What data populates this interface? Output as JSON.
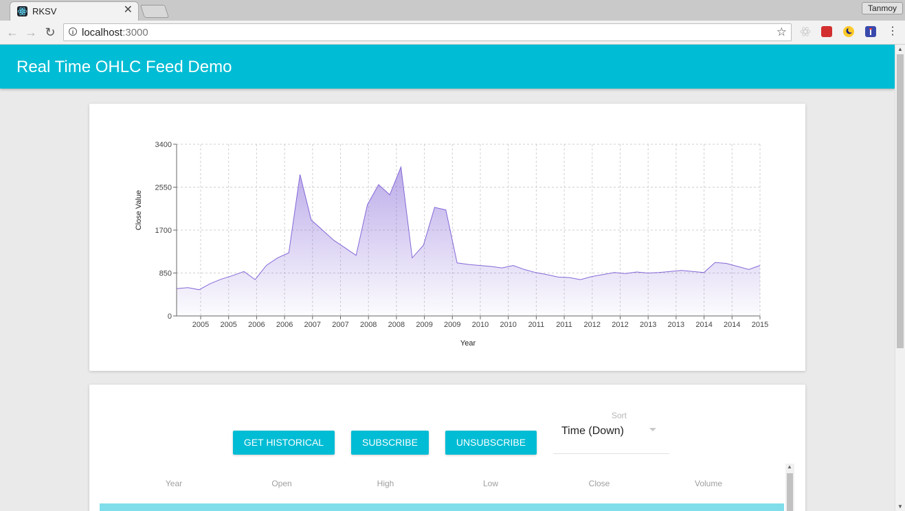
{
  "browser": {
    "tab_title": "RKSV",
    "tab_close": "✕",
    "profile_name": "Tanmoy",
    "url_host": "localhost",
    "url_port": ":3000",
    "star": "☆",
    "menu": "⋮",
    "back": "←",
    "forward": "→",
    "reload": "↻"
  },
  "app": {
    "title": "Real Time OHLC Feed Demo",
    "accent_color": "#00bcd4"
  },
  "chart_data": {
    "type": "area",
    "xlabel": "Year",
    "ylabel": "Close Value",
    "ylim": [
      0,
      3400
    ],
    "yticks": [
      "0",
      "850",
      "1700",
      "2550",
      "3400"
    ],
    "xticks": [
      "2005",
      "2005",
      "2006",
      "2006",
      "2007",
      "2007",
      "2008",
      "2008",
      "2009",
      "2009",
      "2010",
      "2010",
      "2011",
      "2011",
      "2012",
      "2012",
      "2013",
      "2013",
      "2014",
      "2014",
      "2015"
    ],
    "grid": true,
    "color": "#8467d7",
    "series": [
      {
        "x": [
          2004.6,
          2004.8,
          2005.0,
          2005.2,
          2005.4,
          2005.6,
          2005.8,
          2006.0,
          2006.2,
          2006.4,
          2006.6,
          2006.8,
          2007.0,
          2007.2,
          2007.4,
          2007.6,
          2007.8,
          2008.0,
          2008.2,
          2008.4,
          2008.6,
          2008.8,
          2009.0,
          2009.2,
          2009.4,
          2009.6,
          2009.8,
          2010.0,
          2010.2,
          2010.4,
          2010.6,
          2010.8,
          2011.0,
          2011.2,
          2011.4,
          2011.6,
          2011.8,
          2012.0,
          2012.2,
          2012.4,
          2012.6,
          2012.8,
          2013.0,
          2013.2,
          2013.4,
          2013.6,
          2013.8,
          2014.0,
          2014.2,
          2014.4,
          2014.6,
          2014.8,
          2015.0
        ],
        "values": [
          540,
          560,
          520,
          640,
          730,
          800,
          880,
          720,
          1000,
          1150,
          1250,
          2800,
          1900,
          1700,
          1500,
          1350,
          1200,
          2200,
          2600,
          2400,
          2950,
          1150,
          1400,
          2150,
          2100,
          1050,
          1020,
          1000,
          980,
          950,
          1000,
          920,
          860,
          820,
          770,
          760,
          720,
          780,
          820,
          860,
          840,
          870,
          850,
          860,
          880,
          900,
          880,
          860,
          1060,
          1040,
          980,
          920,
          1000
        ]
      }
    ]
  },
  "controls": {
    "get_historical": "GET HISTORICAL",
    "subscribe": "SUBSCRIBE",
    "unsubscribe": "UNSUBSCRIBE",
    "sort_label": "Sort",
    "sort_value": "Time (Down)"
  },
  "table": {
    "columns": [
      "Year",
      "Open",
      "High",
      "Low",
      "Close",
      "Volume"
    ]
  }
}
